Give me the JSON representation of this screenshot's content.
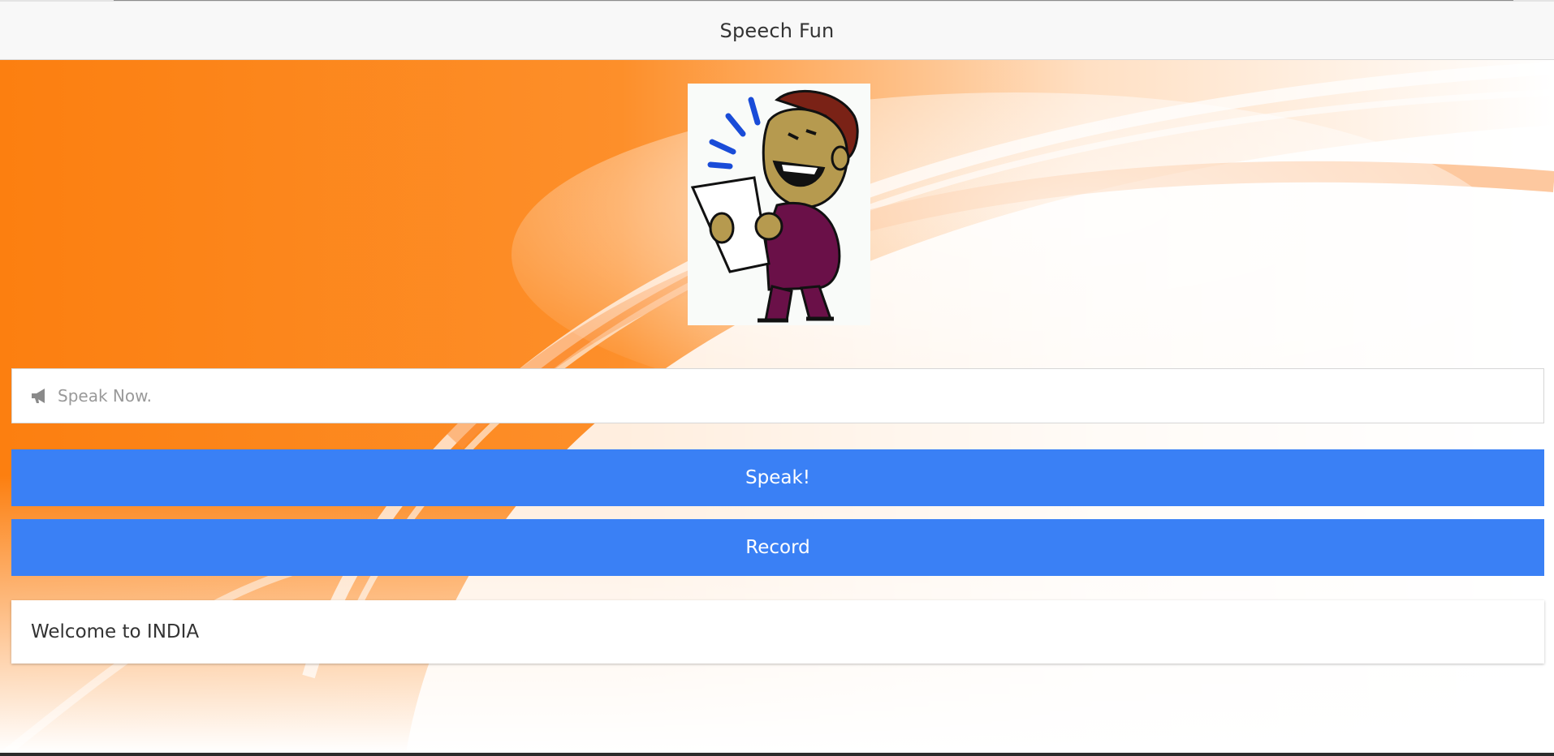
{
  "app": {
    "title": "Speech Fun"
  },
  "header": {
    "title": "Speech Fun"
  },
  "speech_input": {
    "value": "",
    "placeholder": "Speak Now.",
    "icon": "bullhorn-icon"
  },
  "buttons": {
    "speak_label": "Speak!",
    "record_label": "Record"
  },
  "output": {
    "text": "Welcome to INDIA"
  },
  "colors": {
    "accent": "#3a80f5",
    "background_orange": "#fc7f10",
    "header_bg": "#f8f8f8"
  }
}
